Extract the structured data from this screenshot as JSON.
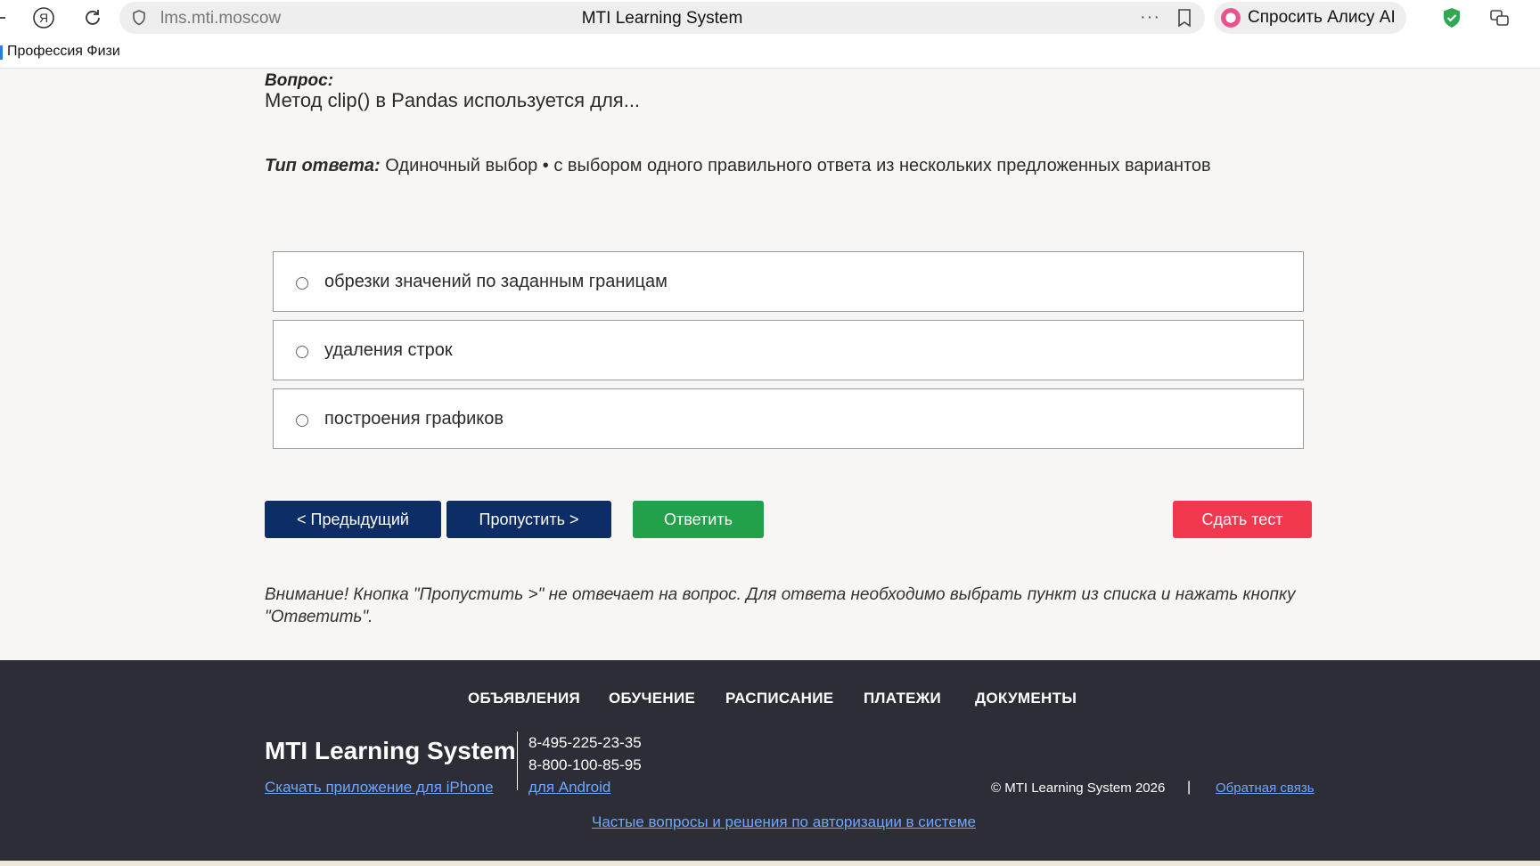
{
  "browser": {
    "url": "lms.mti.moscow",
    "page_title": "MTI Learning System",
    "menu_dots": "···",
    "alice_label": "Спросить Алису AI",
    "bookmark_label": "Профессия Физи"
  },
  "question": {
    "label": "Вопрос:",
    "text": "Метод clip() в Pandas используется для...",
    "answer_type_label": "Тип ответа:",
    "answer_type_text": "Одиночный выбор • с выбором одного правильного ответа из нескольких предложенных вариантов",
    "options": [
      {
        "text": "обрезки значений по заданным границам"
      },
      {
        "text": "удаления строк"
      },
      {
        "text": "построения графиков"
      }
    ]
  },
  "buttons": {
    "prev": "< Предыдущий",
    "skip": "Пропустить >",
    "answer": "Ответить",
    "submit": "Сдать тест"
  },
  "warning": "Внимание! Кнопка \"Пропустить >\" не отвечает на вопрос. Для ответа необходимо выбрать пункт из списка и нажать кнопку \"Ответить\".",
  "footer": {
    "nav": [
      "ОБЪЯВЛЕНИЯ",
      "ОБУЧЕНИЕ",
      "РАСПИСАНИЕ",
      "ПЛАТЕЖИ",
      "ДОКУМЕНТЫ"
    ],
    "brand": "MTI Learning System",
    "phone1": "8-495-225-23-35",
    "phone2": "8-800-100-85-95",
    "iphone_link": "Скачать приложение для iPhone",
    "android_link": "для Android",
    "copyright": "© MTI Learning System 2026",
    "separator": "|",
    "feedback_link": "Обратная связь",
    "faq_link": "Частые вопросы и решения по авторизации в системе"
  },
  "colors": {
    "primary": "#0c2d66",
    "success": "#23a04a",
    "danger": "#f2384f",
    "footer_bg": "#2c2d36",
    "link": "#6fa7ff"
  }
}
